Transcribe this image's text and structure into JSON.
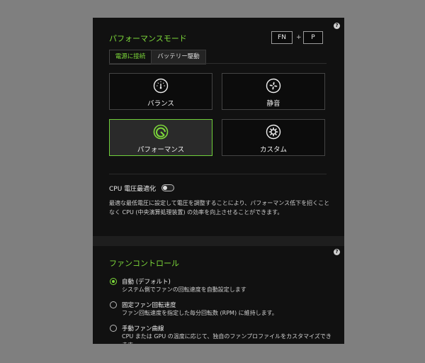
{
  "performance": {
    "title": "パフォーマンスモード",
    "shortcut": {
      "key1": "FN",
      "plus": "+",
      "key2": "P"
    },
    "tabs": [
      {
        "label": "電源に接続",
        "active": true
      },
      {
        "label": "バッテリー駆動",
        "active": false
      }
    ],
    "modes": [
      {
        "label": "バランス",
        "icon": "gauge-icon",
        "selected": false
      },
      {
        "label": "静音",
        "icon": "fan-icon",
        "selected": false
      },
      {
        "label": "パフォーマンス",
        "icon": "performance-icon",
        "selected": true
      },
      {
        "label": "カスタム",
        "icon": "gear-icon",
        "selected": false
      }
    ],
    "cpu_voltage": {
      "label": "CPU 電圧最適化",
      "enabled": false,
      "description": "最適な最低電圧に設定して電圧を調整することにより、パフォーマンス低下を招くことなく CPU (中央演算処理装置) の効率を向上させることができます。"
    },
    "help": "?"
  },
  "fan": {
    "title": "ファンコントロール",
    "help": "?",
    "options": [
      {
        "title": "自動 (デフォルト)",
        "desc": "システム側でファンの回転速度を自動設定します",
        "selected": true
      },
      {
        "title": "固定ファン回転速度",
        "desc": "ファン回転速度を指定した毎分回転数 (RPM) に維持します。",
        "selected": false
      },
      {
        "title": "手動ファン曲線",
        "desc": "CPU または GPU の温度に応じて、独自のファンプロファイルをカスタマイズできます。",
        "selected": false
      }
    ]
  },
  "colors": {
    "accent": "#7dd93a",
    "panel": "#111111",
    "background": "#7f7f7f"
  }
}
